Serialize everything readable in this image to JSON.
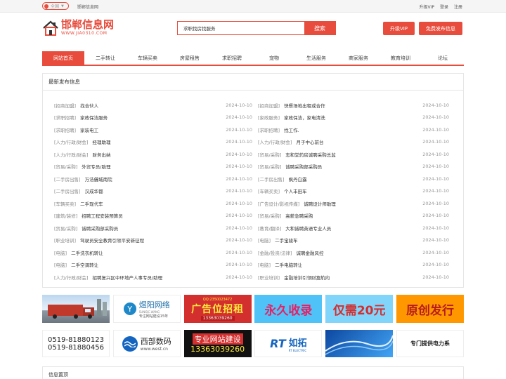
{
  "topbar": {
    "location": "全国",
    "site_home": "邯郸信息网",
    "links": [
      "升级VIP",
      "登录",
      "注册"
    ]
  },
  "logo": {
    "cn": "邯郸信息网",
    "en": "WWW.JIA0310.COM"
  },
  "search": {
    "value": "求职找房找服务",
    "button": "搜索"
  },
  "header_buttons": {
    "vip": "升级VIP",
    "post": "免费发布信息"
  },
  "nav": [
    "网站首页",
    "二手转让",
    "车辆买卖",
    "房屋租售",
    "求职招聘",
    "宠物",
    "生活服务",
    "商家服务",
    "教育培训",
    "论坛"
  ],
  "latest": {
    "title": "最新发布信息",
    "items": [
      {
        "cat": "[招商加盟]",
        "title": "找合伙人",
        "date": "2024-10-10"
      },
      {
        "cat": "[招商加盟]",
        "title": "快餐场地出租或合作",
        "date": "2024-10-10"
      },
      {
        "cat": "[求职招聘]",
        "title": "家政保洁服务",
        "date": "2024-10-10"
      },
      {
        "cat": "[家政服务]",
        "title": "家政保洁，家电清洗",
        "date": "2024-10-10"
      },
      {
        "cat": "[求职招聘]",
        "title": "家装电工",
        "date": "2024-10-10"
      },
      {
        "cat": "[求职招聘]",
        "title": "找工作.",
        "date": "2024-10-10"
      },
      {
        "cat": "[人力/行政/财会]",
        "title": "经理助理",
        "date": "2024-10-10"
      },
      {
        "cat": "[人力/行政/财会]",
        "title": "月子中心前台",
        "date": "2024-10-10"
      },
      {
        "cat": "[人力/行政/财会]",
        "title": "财务出纳",
        "date": "2024-10-10"
      },
      {
        "cat": "[贸易/采购]",
        "title": "志和堂药房诚聘采购总监",
        "date": "2024-10-10"
      },
      {
        "cat": "[贸易/采购]",
        "title": "外贸专员/助理",
        "date": "2024-10-10"
      },
      {
        "cat": "[贸易/采购]",
        "title": "诚聘采购部采购员",
        "date": "2024-10-10"
      },
      {
        "cat": "[二手房出售]",
        "title": "万浩儷城南院",
        "date": "2024-10-10"
      },
      {
        "cat": "[二手房出售]",
        "title": "枫丹白露",
        "date": "2024-10-10"
      },
      {
        "cat": "[二手房出售]",
        "title": "汉成华都",
        "date": "2024-10-10"
      },
      {
        "cat": "[车辆买卖]",
        "title": "个人丰田车",
        "date": "2024-10-10"
      },
      {
        "cat": "[车辆买卖]",
        "title": "二手现代车",
        "date": "2024-10-10"
      },
      {
        "cat": "[广告设计/影视传媒]",
        "title": "诚聘设计师助理",
        "date": "2024-10-10"
      },
      {
        "cat": "[建筑/装修]",
        "title": "招聘工程安装预算员",
        "date": "2024-10-10"
      },
      {
        "cat": "[贸易/采购]",
        "title": "高薪急聘采购",
        "date": "2024-10-10"
      },
      {
        "cat": "[贸易/采购]",
        "title": "诚聘采购部采购员",
        "date": "2024-10-10"
      },
      {
        "cat": "[教育/翻译]",
        "title": "大和诚聘英语专业人员",
        "date": "2024-10-10"
      },
      {
        "cat": "[职业培训]",
        "title": "驾驶员安全教育引领平安新征程",
        "date": "2024-10-10"
      },
      {
        "cat": "[电脑]",
        "title": "二手宝骏车",
        "date": "2024-10-10"
      },
      {
        "cat": "[电脑]",
        "title": "二手洗衣机转让",
        "date": "2024-10-10"
      },
      {
        "cat": "[金融/投资/法律]",
        "title": "诚聘金融风控",
        "date": "2024-10-10"
      },
      {
        "cat": "[电脑]",
        "title": "二手空调转让",
        "date": "2024-10-10"
      },
      {
        "cat": "[电脑]",
        "title": "二手电脑转让",
        "date": "2024-10-10"
      },
      {
        "cat": "[人力/行政/财会]",
        "title": "招聘复兴区中环地产人事专员/助理",
        "date": "2024-10-10"
      },
      {
        "cat": "[职业培训]",
        "title": "金融培训引领财富航向",
        "date": "2024-10-10"
      }
    ]
  },
  "ads_row1": [
    {
      "name": "truck-ad",
      "text": ""
    },
    {
      "name": "yunyang-ad",
      "text": "煜阳网络",
      "sub": "专注网站建设15年",
      "en": "SUNIDC.WANG"
    },
    {
      "name": "ad-space-ad",
      "text": "广告位招租",
      "sub": "13363039260",
      "qq": "QQ:2350023472"
    },
    {
      "name": "permanent-ad",
      "text": "永久收录"
    },
    {
      "name": "price-ad",
      "text": "仅需20元"
    },
    {
      "name": "original-ad",
      "text": "原创发行"
    }
  ],
  "ads_row2": [
    {
      "name": "phone-ad",
      "lines": [
        "0519-81880123",
        "0519-81880456"
      ]
    },
    {
      "name": "west-ad",
      "text": "西部数码",
      "sub": "www.west.cn"
    },
    {
      "name": "website-build-ad",
      "text": "专业网站建设",
      "sub": "13363039260"
    },
    {
      "name": "rutuo-ad",
      "text": "如拓",
      "sub": "RT ELECTRIC"
    },
    {
      "name": "cable-ad",
      "text": ""
    },
    {
      "name": "power-ad",
      "text": "专门提供电力系"
    }
  ],
  "info_bar": {
    "title": "信息置顶"
  },
  "colors": {
    "accent": "#e74c3c"
  }
}
